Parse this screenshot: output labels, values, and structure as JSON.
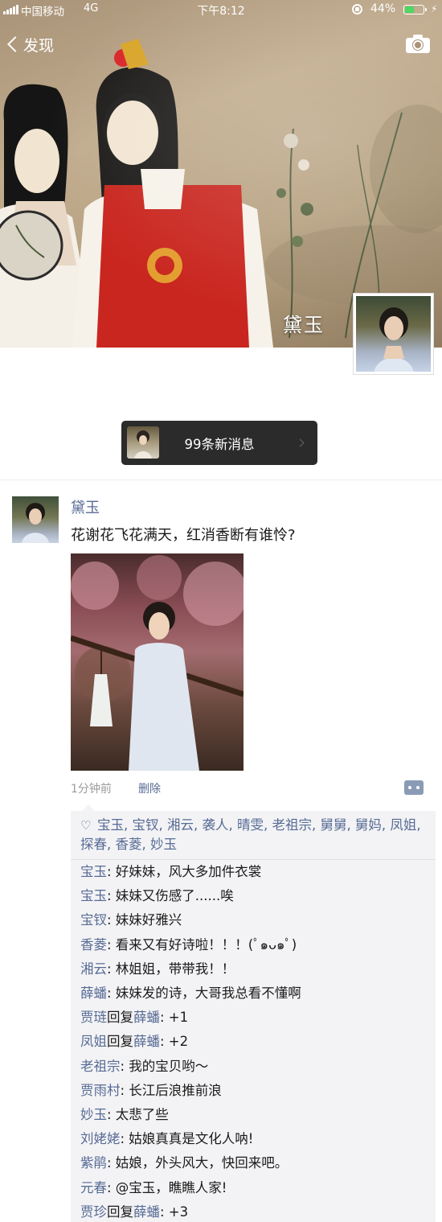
{
  "status_bar": {
    "carrier": "中国移动",
    "network": "4G",
    "time": "下午8:12",
    "battery": "44%",
    "battery_level": 0.44
  },
  "nav": {
    "back_label": "发现",
    "icons": [
      "camera-icon"
    ]
  },
  "cover": {
    "name": "黛玉"
  },
  "new_messages": {
    "label": "99条新消息"
  },
  "post": {
    "author": "黛玉",
    "text": "花谢花飞花满天，红消香断有谁怜?",
    "time": "1分钟前",
    "delete_label": "删除"
  },
  "likes": {
    "names": "宝玉, 宝钗, 湘云, 袭人, 晴雯, 老祖宗, 舅舅, 舅妈, 凤姐, 探春, 香菱, 妙玉"
  },
  "comments": [
    {
      "author": "宝玉",
      "text": ": 好妹妹，风大多加件衣裳"
    },
    {
      "author": "宝玉",
      "text": ": 妹妹又伤感了......唉"
    },
    {
      "author": "宝钗",
      "text": ": 妹妹好雅兴"
    },
    {
      "author": "香菱",
      "text": ": 看来又有好诗啦！！！(ﾟ๑ᴗ๑ﾟ)"
    },
    {
      "author": "湘云",
      "text": ": 林姐姐，带带我！！"
    },
    {
      "author": "薛蟠",
      "text": ": 妹妹发的诗，大哥我总看不懂啊"
    },
    {
      "author": "贾琏",
      "reply_word": "回复",
      "reply_to": "薛蟠",
      "text": ": +1"
    },
    {
      "author": "凤姐",
      "reply_word": "回复",
      "reply_to": "薛蟠",
      "text": ": +2"
    },
    {
      "author": "老祖宗",
      "text": ": 我的宝贝哟～"
    },
    {
      "author": "贾雨村",
      "text": ": 长江后浪推前浪"
    },
    {
      "author": "妙玉",
      "text": ": 太悲了些"
    },
    {
      "author": "刘姥姥",
      "text": ": 姑娘真真是文化人呐!"
    },
    {
      "author": "紫鹃",
      "text": ": 姑娘，外头风大，快回来吧。"
    },
    {
      "author": "元春",
      "text": ": @宝玉，瞧瞧人家!"
    },
    {
      "author": "贾珍",
      "reply_word": "回复",
      "reply_to": "薛蟠",
      "text": ": +3"
    }
  ]
}
